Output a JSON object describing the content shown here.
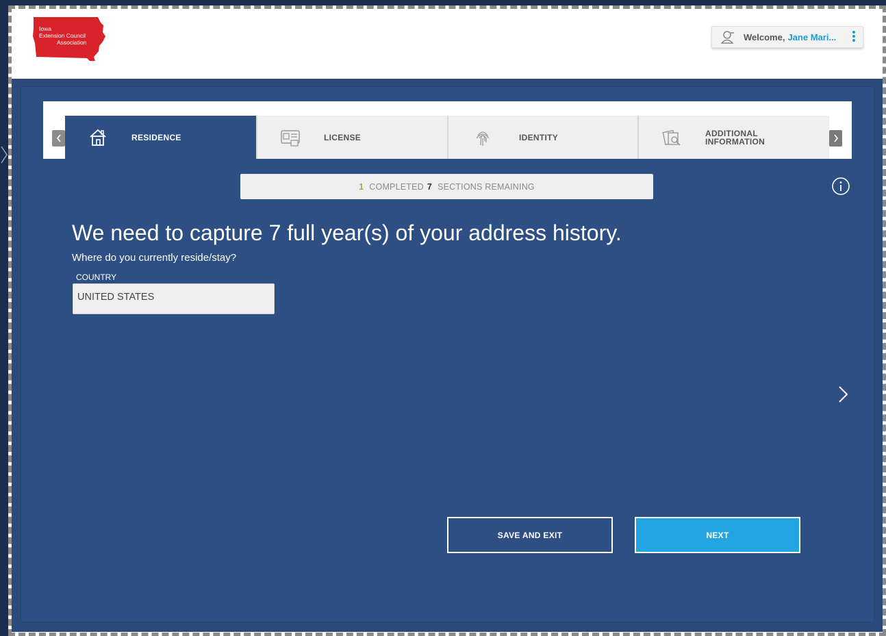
{
  "header": {
    "logo": {
      "line1": "Iowa",
      "line2": "Extension Council",
      "line3": "Association",
      "color": "#d8232a"
    },
    "welcome_label": "Welcome,",
    "user_name": "Jane Mari..."
  },
  "tabs": [
    {
      "label": "RESIDENCE",
      "icon": "house-icon",
      "active": true
    },
    {
      "label": "LICENSE",
      "icon": "id-card-icon",
      "active": false
    },
    {
      "label": "IDENTITY",
      "icon": "fingerprint-icon",
      "active": false
    },
    {
      "label_line1": "ADDITIONAL",
      "label_line2": "INFORMATION",
      "icon": "documents-icon",
      "active": false
    }
  ],
  "progress": {
    "completed_count": "1",
    "completed_label": "COMPLETED",
    "remaining_count": "7",
    "remaining_label": "SECTIONS REMAINING"
  },
  "main": {
    "headline": "We need to capture 7 full year(s) of your address history.",
    "question": "Where do you currently reside/stay?",
    "country_label": "COUNTRY",
    "country_value": "UNITED STATES"
  },
  "buttons": {
    "save_exit": "SAVE AND EXIT",
    "next": "NEXT"
  },
  "colors": {
    "panel": "#2d4f83",
    "accent": "#22a5e0",
    "progress_done": "#8bb33a"
  }
}
